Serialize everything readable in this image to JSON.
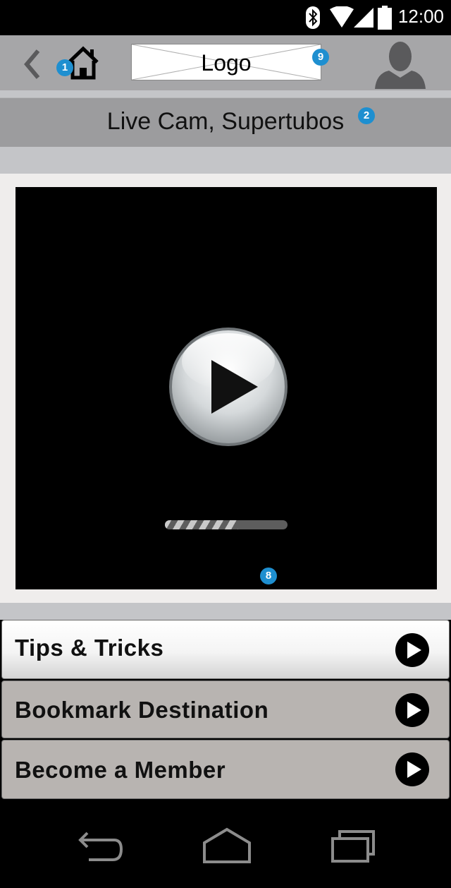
{
  "status_bar": {
    "time": "12:00"
  },
  "app_bar": {
    "logo_text": "Logo"
  },
  "page": {
    "title": "Live Cam, Supertubos"
  },
  "annotations": {
    "home": "1",
    "title": "2",
    "video": "8",
    "logo": "9"
  },
  "video": {
    "buffer_progress": 0.6
  },
  "menu": [
    {
      "label": "Tips & Tricks"
    },
    {
      "label": "Bookmark Destination"
    },
    {
      "label": "Become a Member"
    }
  ],
  "icons": [
    "bluetooth-icon",
    "wifi-icon",
    "signal-icon",
    "battery-icon",
    "back-chevron-icon",
    "home-icon",
    "avatar-icon",
    "play-icon",
    "back-nav-icon",
    "home-nav-icon",
    "recents-nav-icon"
  ],
  "colors": {
    "badge": "#1e8fd0",
    "app_bar": "#a6a6a8",
    "title_bar": "#9c9c9e",
    "menu_bg": "#b8b4b1"
  }
}
